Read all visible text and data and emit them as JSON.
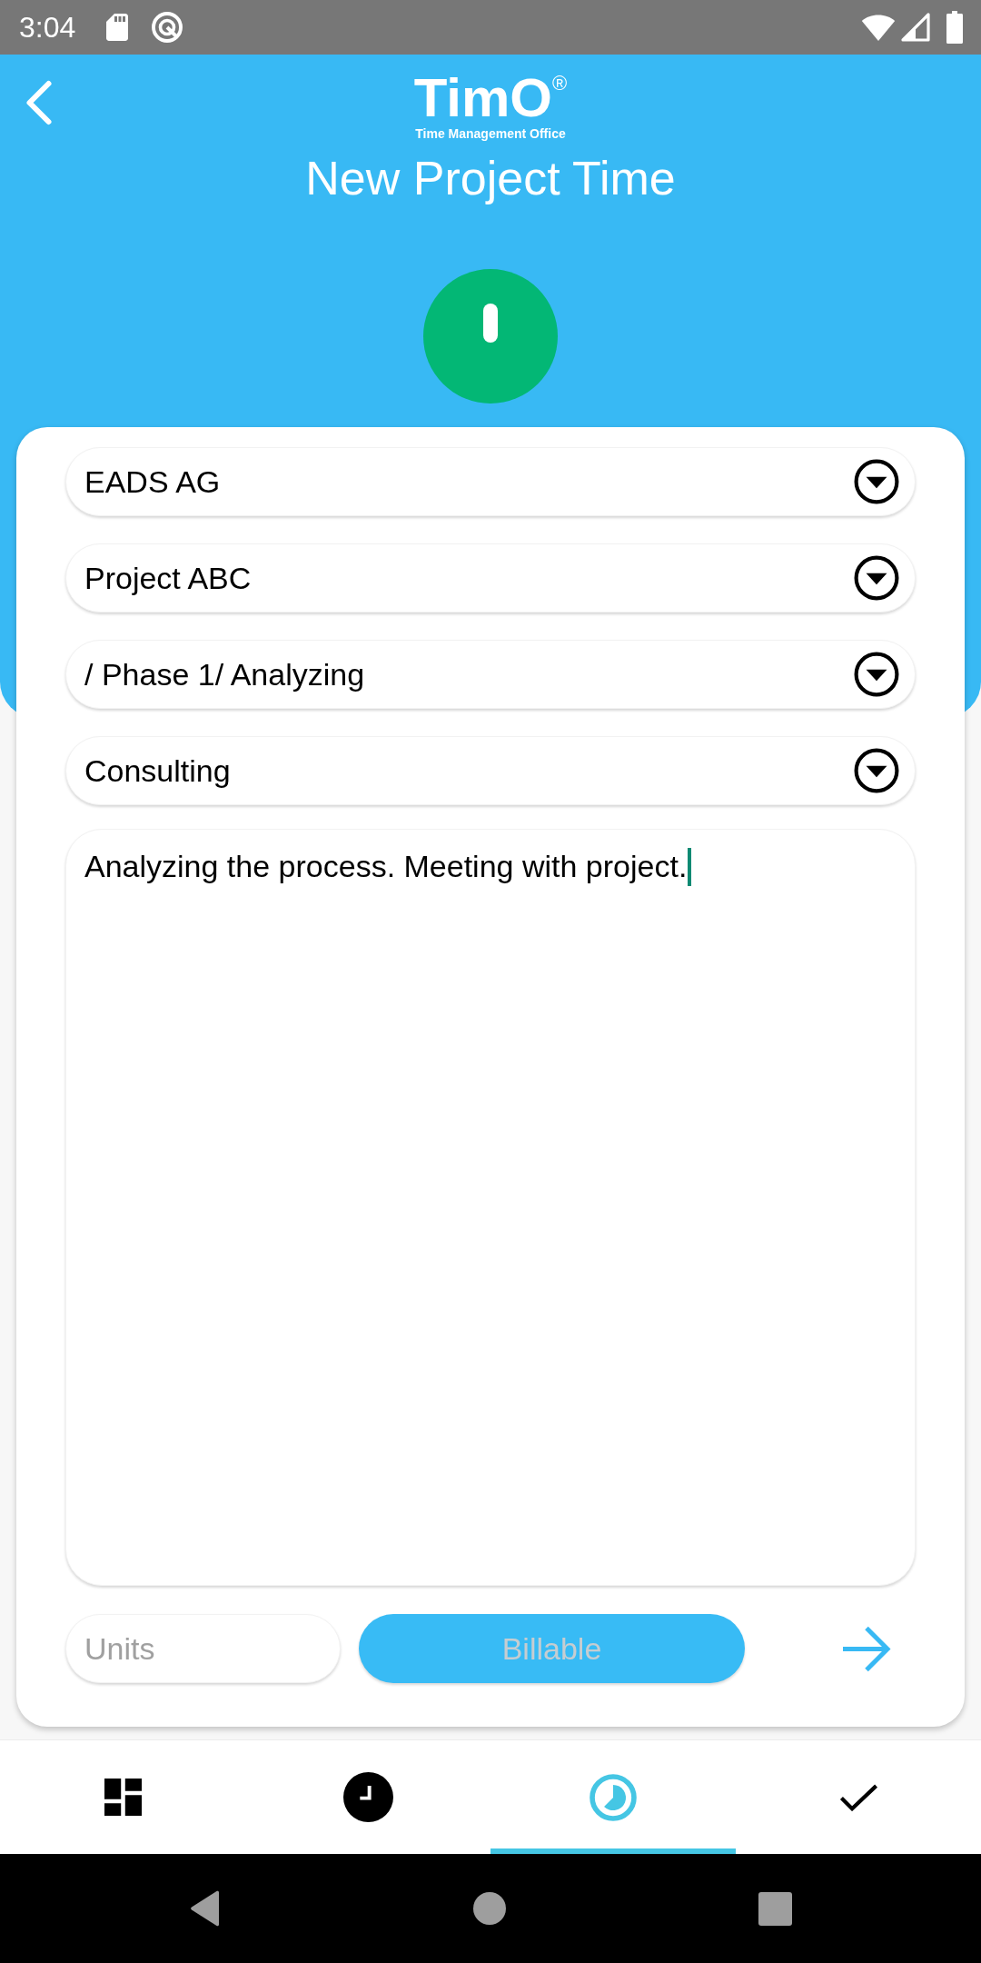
{
  "status_bar": {
    "time": "3:04"
  },
  "header": {
    "logo": "TimO$^{®}$",
    "logo_tagline": "Time Management Office",
    "title": "New Project Time"
  },
  "dropdowns": [
    {
      "value": "EADS AG"
    },
    {
      "value": "Project ABC"
    },
    {
      "value": "/ Phase 1/ Analyzing"
    },
    {
      "value": "Consulting"
    }
  ],
  "description": {
    "value": "Analyzing the process. Meeting with project.",
    "focused": true
  },
  "units": {
    "placeholder": "Units"
  },
  "billable": {
    "label": "Billable",
    "on": false
  },
  "bottom_nav": [
    {
      "kind": "dashboard",
      "selected": false
    },
    {
      "kind": "clock",
      "selected": false
    },
    {
      "kind": "timer",
      "selected": true
    },
    {
      "kind": "check",
      "selected": false
    }
  ]
}
